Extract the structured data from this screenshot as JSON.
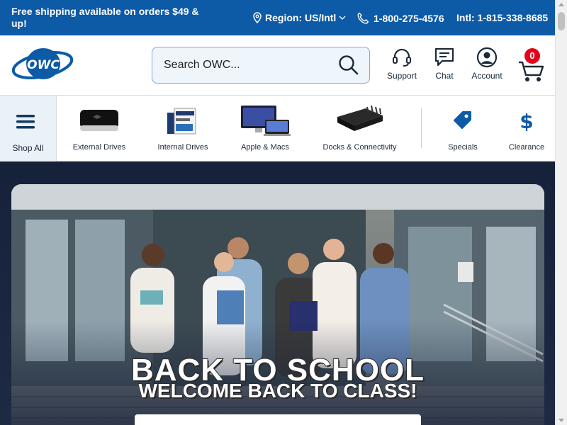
{
  "topbar": {
    "shipping_text": "Free shipping available on orders $49 & up!",
    "region_label": "Region: US/Intl",
    "phone": "1-800-275-4576",
    "intl_phone": "Intl: 1-815-338-8685"
  },
  "header": {
    "logo_text": "OWC",
    "search_placeholder": "Search OWC...",
    "support_label": "Support",
    "chat_label": "Chat",
    "account_label": "Account",
    "cart_count": "0"
  },
  "categories": [
    {
      "label": "Shop All",
      "icon": "menu-icon"
    },
    {
      "label": "External Drives",
      "icon": "external-drive-image"
    },
    {
      "label": "Internal Drives",
      "icon": "internal-drive-image"
    },
    {
      "label": "Apple & Macs",
      "icon": "apple-macs-image"
    },
    {
      "label": "Docks & Connectivity",
      "icon": "dock-image"
    },
    {
      "label": "Specials",
      "icon": "tag-icon"
    },
    {
      "label": "Clearance",
      "icon": "dollar-icon"
    }
  ],
  "hero": {
    "title": "BACK TO SCHOOL",
    "subtitle": "WELCOME BACK TO CLASS!"
  },
  "colors": {
    "brand_blue": "#0d5aa7",
    "badge_red": "#e3001b",
    "hero_navy": "#16223a"
  }
}
